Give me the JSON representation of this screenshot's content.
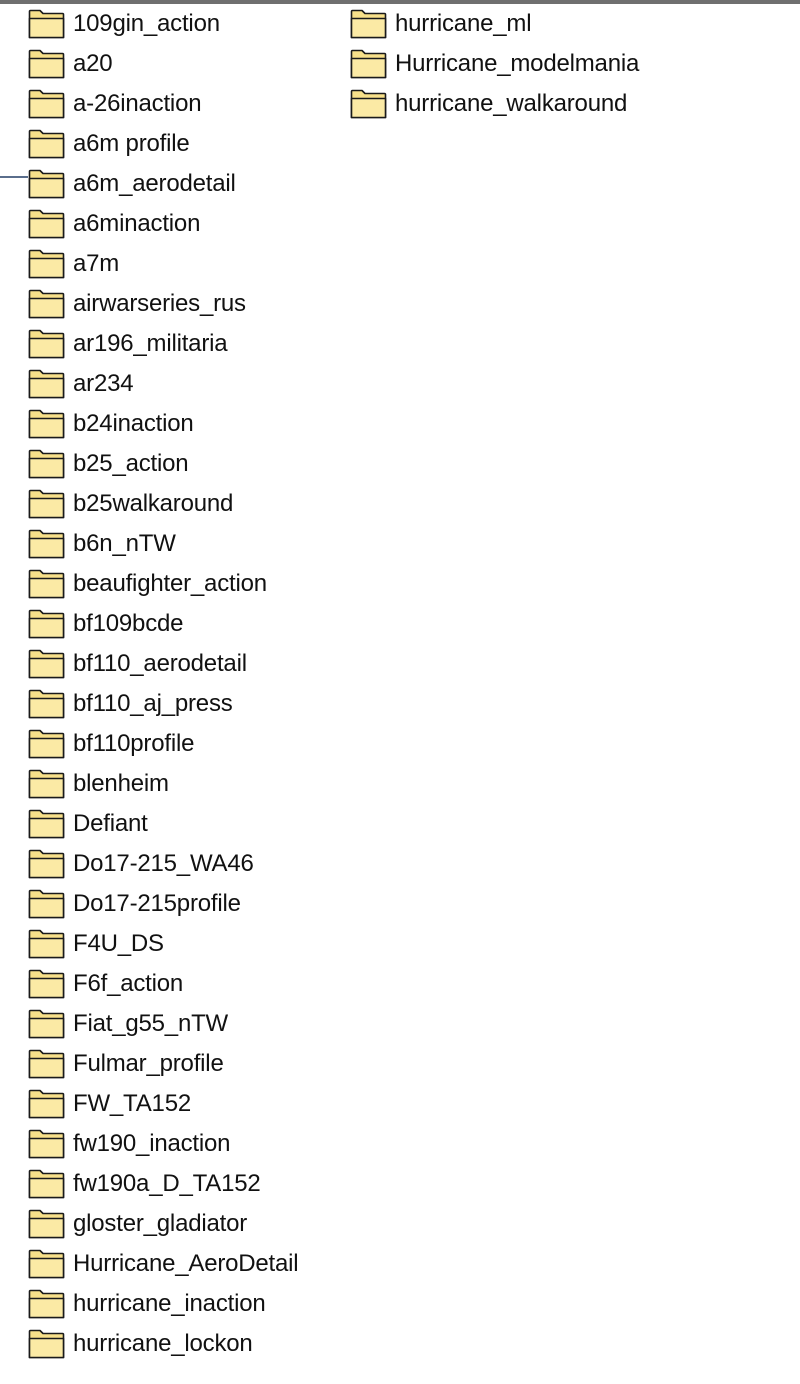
{
  "folder_icon": {
    "name": "folder-icon",
    "fill": "#f7e08a",
    "front_fill": "#fbeaa5",
    "outline": "#1a1a1a"
  },
  "columns": [
    {
      "items": [
        "109gin_action",
        "a20",
        "a-26inaction",
        "a6m profile",
        "a6m_aerodetail",
        "a6minaction",
        "a7m",
        "airwarseries_rus",
        "ar196_militaria",
        "ar234",
        "b24inaction",
        "b25_action",
        "b25walkaround",
        "b6n_nTW",
        "beaufighter_action",
        "bf109bcde",
        "bf110_aerodetail",
        "bf110_aj_press",
        "bf110profile",
        "blenheim",
        "Defiant",
        "Do17-215_WA46",
        "Do17-215profile",
        "F4U_DS",
        "F6f_action",
        "Fiat_g55_nTW",
        "Fulmar_profile",
        "FW_TA152",
        "fw190_inaction",
        "fw190a_D_TA152",
        "gloster_gladiator",
        "Hurricane_AeroDetail",
        "hurricane_inaction",
        "hurricane_lockon"
      ]
    },
    {
      "items": [
        "hurricane_ml",
        "Hurricane_modelmania",
        "hurricane_walkaround"
      ]
    }
  ]
}
